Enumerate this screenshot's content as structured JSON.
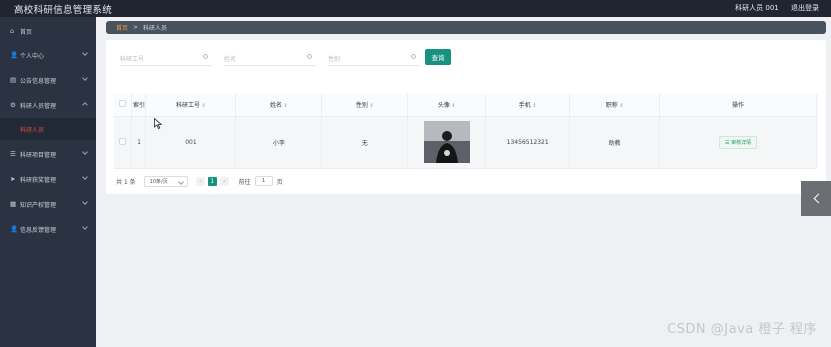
{
  "app": {
    "title": "高校科研信息管理系统"
  },
  "topbar": {
    "user_label": "科研人员 001",
    "logout_label": "退出登录"
  },
  "sidebar": {
    "items": [
      {
        "label": "首页",
        "icon": "home-icon",
        "glyph": "⌂"
      },
      {
        "label": "个人中心",
        "icon": "person-icon",
        "glyph": "👤"
      },
      {
        "label": "公告信息管理",
        "icon": "bank-icon",
        "glyph": "▤"
      },
      {
        "label": "科研人员管理",
        "icon": "gear-icon",
        "glyph": "⚙"
      },
      {
        "label": "科研项目管理",
        "icon": "list-icon",
        "glyph": "☰"
      },
      {
        "label": "科研获奖管理",
        "icon": "send-icon",
        "glyph": "➤"
      },
      {
        "label": "知识产权管理",
        "icon": "book-icon",
        "glyph": "▦"
      },
      {
        "label": "信息反馈管理",
        "icon": "user-icon",
        "glyph": "👤"
      }
    ],
    "active_sub": "科研人员"
  },
  "breadcrumb": {
    "home": "首页",
    "separator": ">",
    "current": "科研人员"
  },
  "search": {
    "fields": [
      {
        "placeholder": "科研工号"
      },
      {
        "placeholder": "姓名"
      },
      {
        "placeholder": "性别"
      }
    ],
    "query_label": "查询"
  },
  "table": {
    "headers": [
      "索引",
      "科研工号",
      "姓名",
      "性别",
      "头像",
      "手机",
      "职称",
      "操作"
    ],
    "rows": [
      {
        "index": "1",
        "staff_no": "001",
        "name": "小李",
        "gender": "无",
        "phone": "13456512321",
        "title": "助教",
        "action": "审核详情"
      }
    ]
  },
  "pagination": {
    "total": "共 1 条",
    "page_size": "10条/页",
    "current_page": "1",
    "goto_label": "前往",
    "goto_value": "1",
    "page_unit": "页"
  },
  "watermark": "CSDN @Java 橙子 程序"
}
